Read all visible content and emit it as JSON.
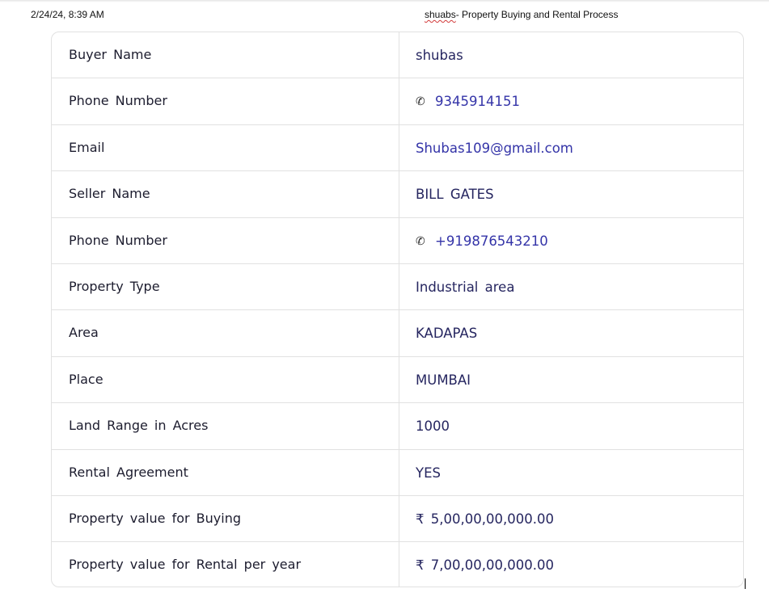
{
  "header": {
    "date": "2/24/24, 8:39 AM",
    "title_prefix": "shuabs",
    "title_rest": "- Property Buying and Rental Process"
  },
  "rows": [
    {
      "label": "Buyer Name",
      "value": "shubas"
    },
    {
      "label": "Phone Number",
      "value": "9345914151",
      "icon": "phone-icon"
    },
    {
      "label": "Email",
      "value": "Shubas109@gmail.com"
    },
    {
      "label": "Seller Name",
      "value": "BILL GATES"
    },
    {
      "label": "Phone Number",
      "value": "+919876543210",
      "icon": "phone-icon"
    },
    {
      "label": "Property Type",
      "value": "Industrial area"
    },
    {
      "label": "Area",
      "value": "KADAPAS"
    },
    {
      "label": "Place",
      "value": "MUMBAI"
    },
    {
      "label": "Land Range in Acres",
      "value": "1000"
    },
    {
      "label": "Rental Agreement",
      "value": "YES"
    },
    {
      "label": "Property value for Buying",
      "value": "₹ 5,00,00,00,000.00"
    },
    {
      "label": "Property value for Rental per year",
      "value": "₹ 7,00,00,00,000.00"
    }
  ],
  "colors": {
    "link": "#3434a8",
    "value_text": "#262660",
    "border": "#e1e1e1"
  }
}
